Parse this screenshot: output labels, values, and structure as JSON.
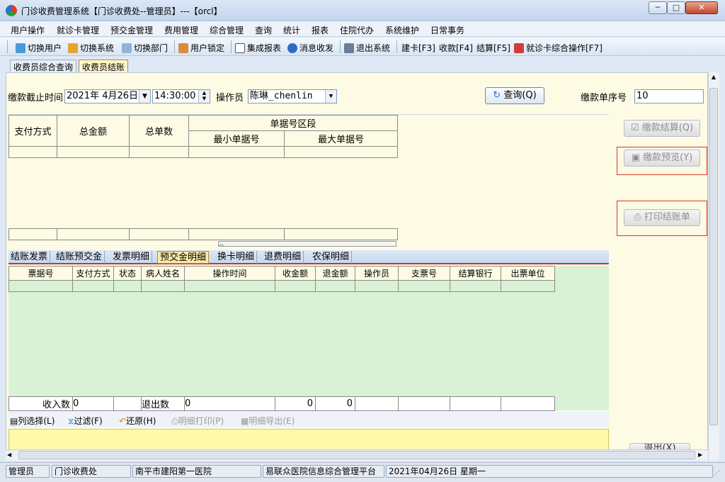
{
  "window": {
    "title": "门诊收费管理系统【门诊收费处--管理员】---【orcl】"
  },
  "menu": [
    "用户操作",
    "就诊卡管理",
    "预交金管理",
    "费用管理",
    "综合管理",
    "查询",
    "统计",
    "报表",
    "住院代办",
    "系统维护",
    "日常事务"
  ],
  "toolbar": {
    "switch_user": "切换用户",
    "switch_system": "切换系统",
    "switch_dept": "切换部门",
    "lock_user": "用户锁定",
    "integrated_report": "集成报表",
    "messages": "消息收发",
    "exit_system": "退出系统",
    "new_card": "建卡[F3]",
    "charge": "收款[F4]",
    "settle": "结算[F5]",
    "card_ops": "就诊卡综合操作[F7]"
  },
  "top_tabs": [
    "收费员综合查询",
    "收费员结账"
  ],
  "query": {
    "cutoff_label": "缴款截止时间",
    "date": "2021年 4月26日",
    "time": "14:30:00",
    "operator_label": "操作员",
    "operator": "陈琳_chenlin",
    "query_button": "查询(Q)",
    "serial_label": "缴款单序号",
    "serial": "10"
  },
  "upper_grid": {
    "headers": [
      "支付方式",
      "总金额",
      "总单数",
      "单据号区段"
    ],
    "subheaders": [
      "最小单据号",
      "最大单据号"
    ]
  },
  "side_buttons": {
    "settle": "缴款结算(Q)",
    "preview": "缴款预览(Y)",
    "print": "打印结账单",
    "exit": "退出(X)"
  },
  "lower_tabs": [
    "结账发票",
    "结账预交金",
    "发票明细",
    "预交金明细",
    "换卡明细",
    "退费明细",
    "农保明细"
  ],
  "lower_grid": {
    "headers": [
      "票据号",
      "支付方式",
      "状态",
      "病人姓名",
      "操作时间",
      "收金额",
      "退金额",
      "操作员",
      "支票号",
      "结算银行",
      "出票单位"
    ]
  },
  "totals": {
    "income_count_label": "收入数",
    "income_count": "0",
    "refund_count_label": "退出数",
    "refund_count": "0",
    "income_amount": "0",
    "refund_amount": "0"
  },
  "bottom_toolbar": {
    "column_select": "列选择(L)",
    "filter": "过滤(F)",
    "restore": "还原(H)",
    "print_detail": "明细打印(P)",
    "export_detail": "明细导出(E)"
  },
  "status": {
    "user": "管理员",
    "dept": "门诊收费处",
    "hospital": "南平市建阳第一医院",
    "platform": "易联众医院信息综合管理平台",
    "date": "2021年04月26日 星期一"
  }
}
